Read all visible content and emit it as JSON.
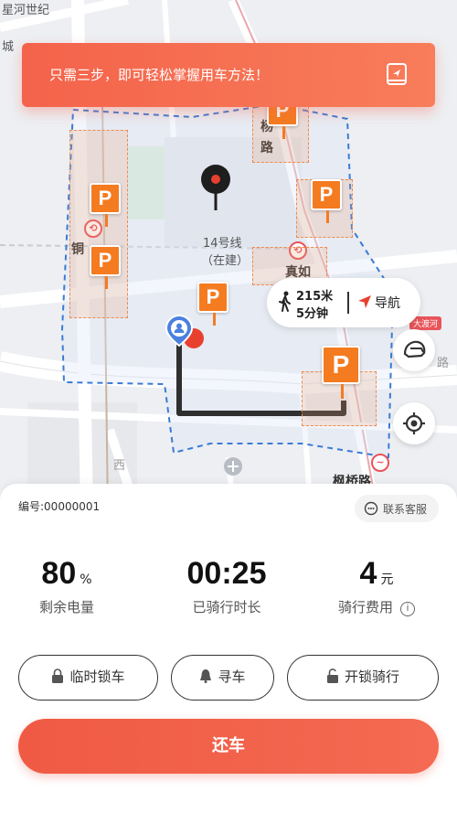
{
  "colors": {
    "accent": "#f05a44",
    "parking": "#f47b20",
    "route": "#333333",
    "zone_border": "#3a7bd5"
  },
  "map": {
    "labels": {
      "poi_top_left_1": "星河世纪",
      "poi_top_left_2": "城",
      "road_yang": "杨",
      "road_lu": "路",
      "line14": "14号线",
      "line14_status": "（在建）",
      "station_zhenru": "真如",
      "station_tong": "铜",
      "road_bottom": "枫桥路",
      "road_left": "西",
      "road_right": "路",
      "metro_badge": "大渡河"
    },
    "parking_letter": "P",
    "route_info": {
      "distance": "215米",
      "time": "5分钟",
      "nav_label": "导航"
    },
    "buttons": {
      "helmet": "helmet-icon",
      "locate": "locate-icon"
    }
  },
  "banner": {
    "text": "只需三步，即可轻松掌握用车方法！",
    "icon": "guide-book-icon"
  },
  "panel": {
    "serial": "编号:00000001",
    "contact": "联系客服",
    "stats": [
      {
        "value": "80",
        "unit": "%",
        "label": "剩余电量"
      },
      {
        "value": "00:25",
        "unit": "",
        "label": "已骑行时长"
      },
      {
        "value": "4",
        "unit": "元",
        "label": "骑行费用"
      }
    ],
    "actions": {
      "lock_temp": "临时锁车",
      "find_car": "寻车",
      "unlock_ride": "开锁骑行"
    },
    "return_label": "还车"
  }
}
